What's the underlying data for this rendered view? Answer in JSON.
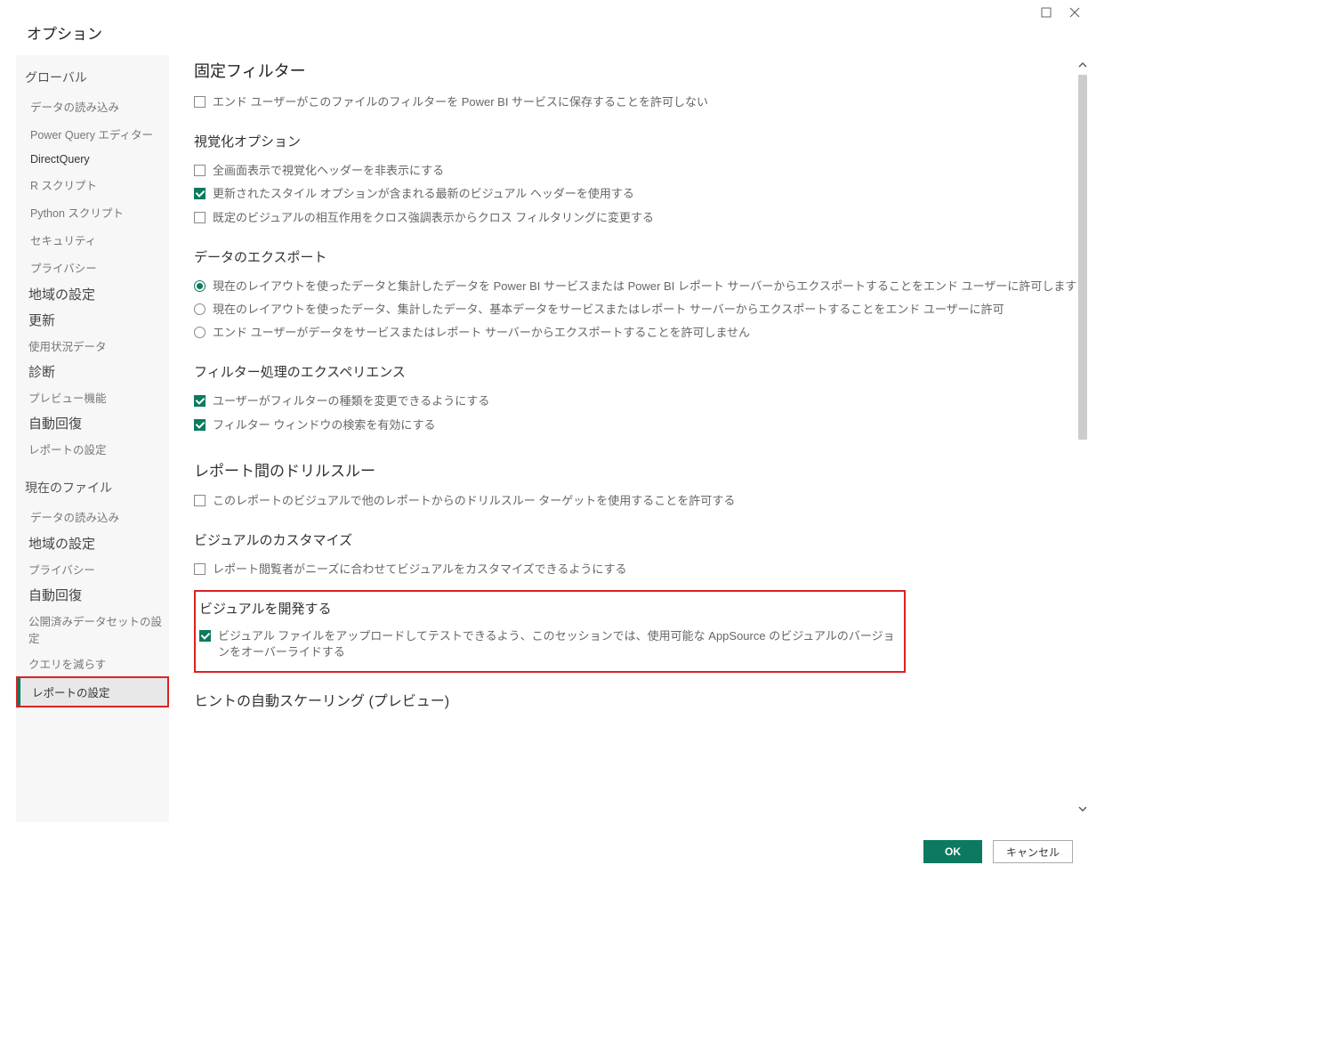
{
  "window": {
    "title": "オプション"
  },
  "sidebar": {
    "global_header": "グローバル",
    "global_items": {
      "data_load": "データの読み込み",
      "power_query": "Power Query エディター",
      "directquery": "DirectQuery",
      "r_script": "R スクリプト",
      "python_script": "Python スクリプト",
      "security": "セキュリティ",
      "privacy": "プライバシー"
    },
    "region_settings": "地域の設定",
    "update": "更新",
    "usage_data": "使用状況データ",
    "diagnostics": "診断",
    "preview_features": "プレビュー機能",
    "auto_recovery": "自動回復",
    "report_settings_g": "レポートの設定",
    "current_file_header": "現在のファイル",
    "current_items": {
      "data_load": "データの読み込み"
    },
    "region_settings2": "地域の設定",
    "privacy2": "プライバシー",
    "auto_recovery2": "自動回復",
    "published_dataset": "公開済みデータセットの設定",
    "reduce_query": "クエリを減らす",
    "report_settings_active": "レポートの設定"
  },
  "content": {
    "fixed_filter_title": "固定フィルター",
    "fixed_filter_opt1": "エンド ユーザーがこのファイルのフィルターを Power BI サービスに保存することを許可しない",
    "visual_options_title": "視覚化オプション",
    "visual_opt1": "全画面表示で視覚化ヘッダーを非表示にする",
    "visual_opt2": "更新されたスタイル オプションが含まれる最新のビジュアル ヘッダーを使用する",
    "visual_opt3": "既定のビジュアルの相互作用をクロス強調表示からクロス フィルタリングに変更する",
    "data_export_title": "データのエクスポート",
    "data_export_r1": "現在のレイアウトを使ったデータと集計したデータを Power BI サービスまたは Power BI レポート サーバーからエクスポートすることをエンド ユーザーに許可します",
    "data_export_r2": "現在のレイアウトを使ったデータ、集計したデータ、基本データをサービスまたはレポート サーバーからエクスポートすることをエンド ユーザーに許可",
    "data_export_r3": "エンド ユーザーがデータをサービスまたはレポート サーバーからエクスポートすることを許可しません",
    "filter_exp_title": "フィルター処理のエクスペリエンス",
    "filter_exp_opt1": "ユーザーがフィルターの種類を変更できるようにする",
    "filter_exp_opt2": "フィルター ウィンドウの検索を有効にする",
    "drillthrough_title": "レポート間のドリルスルー",
    "drillthrough_opt1": "このレポートのビジュアルで他のレポートからのドリルスルー ターゲットを使用することを許可する",
    "customize_title": "ビジュアルのカスタマイズ",
    "customize_opt1": "レポート閲覧者がニーズに合わせてビジュアルをカスタマイズできるようにする",
    "develop_visual_title": "ビジュアルを開発する",
    "develop_visual_opt1": "ビジュアル ファイルをアップロードしてテストできるよう、このセッションでは、使用可能な AppSource のビジュアルのバージョンをオーバーライドする",
    "hint_scaling_title": "ヒントの自動スケーリング (プレビュー)"
  },
  "footer": {
    "ok": "OK",
    "cancel": "キャンセル"
  }
}
